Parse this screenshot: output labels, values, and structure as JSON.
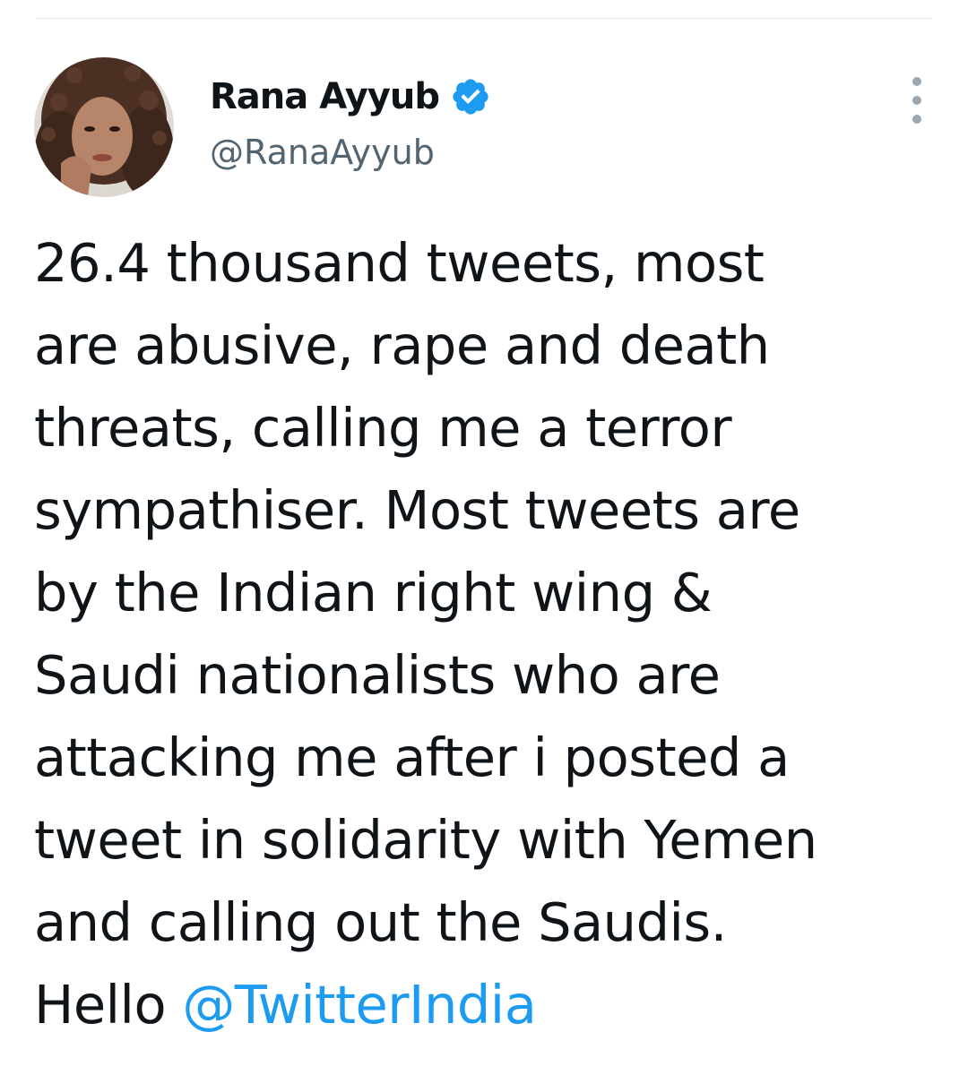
{
  "author": {
    "display_name": "Rana Ayyub",
    "handle": "@RanaAyyub",
    "verified": true
  },
  "tweet": {
    "lines": [
      "26.4 thousand tweets, most",
      "are abusive, rape and death",
      "threats, calling me a terror",
      "sympathiser. Most tweets are",
      "by the Indian right wing &",
      "Saudi nationalists who are",
      "attacking me after i posted a",
      "tweet in solidarity with Yemen",
      "and calling out the Saudis."
    ],
    "last_line_prefix": "Hello ",
    "mention": "@TwitterIndia"
  },
  "icons": {
    "verified": "verified-badge-icon",
    "more": "more-options-icon"
  },
  "colors": {
    "text": "#0f1419",
    "secondary": "#536471",
    "link": "#1d9bf0",
    "verified": "#1d9bf0"
  }
}
